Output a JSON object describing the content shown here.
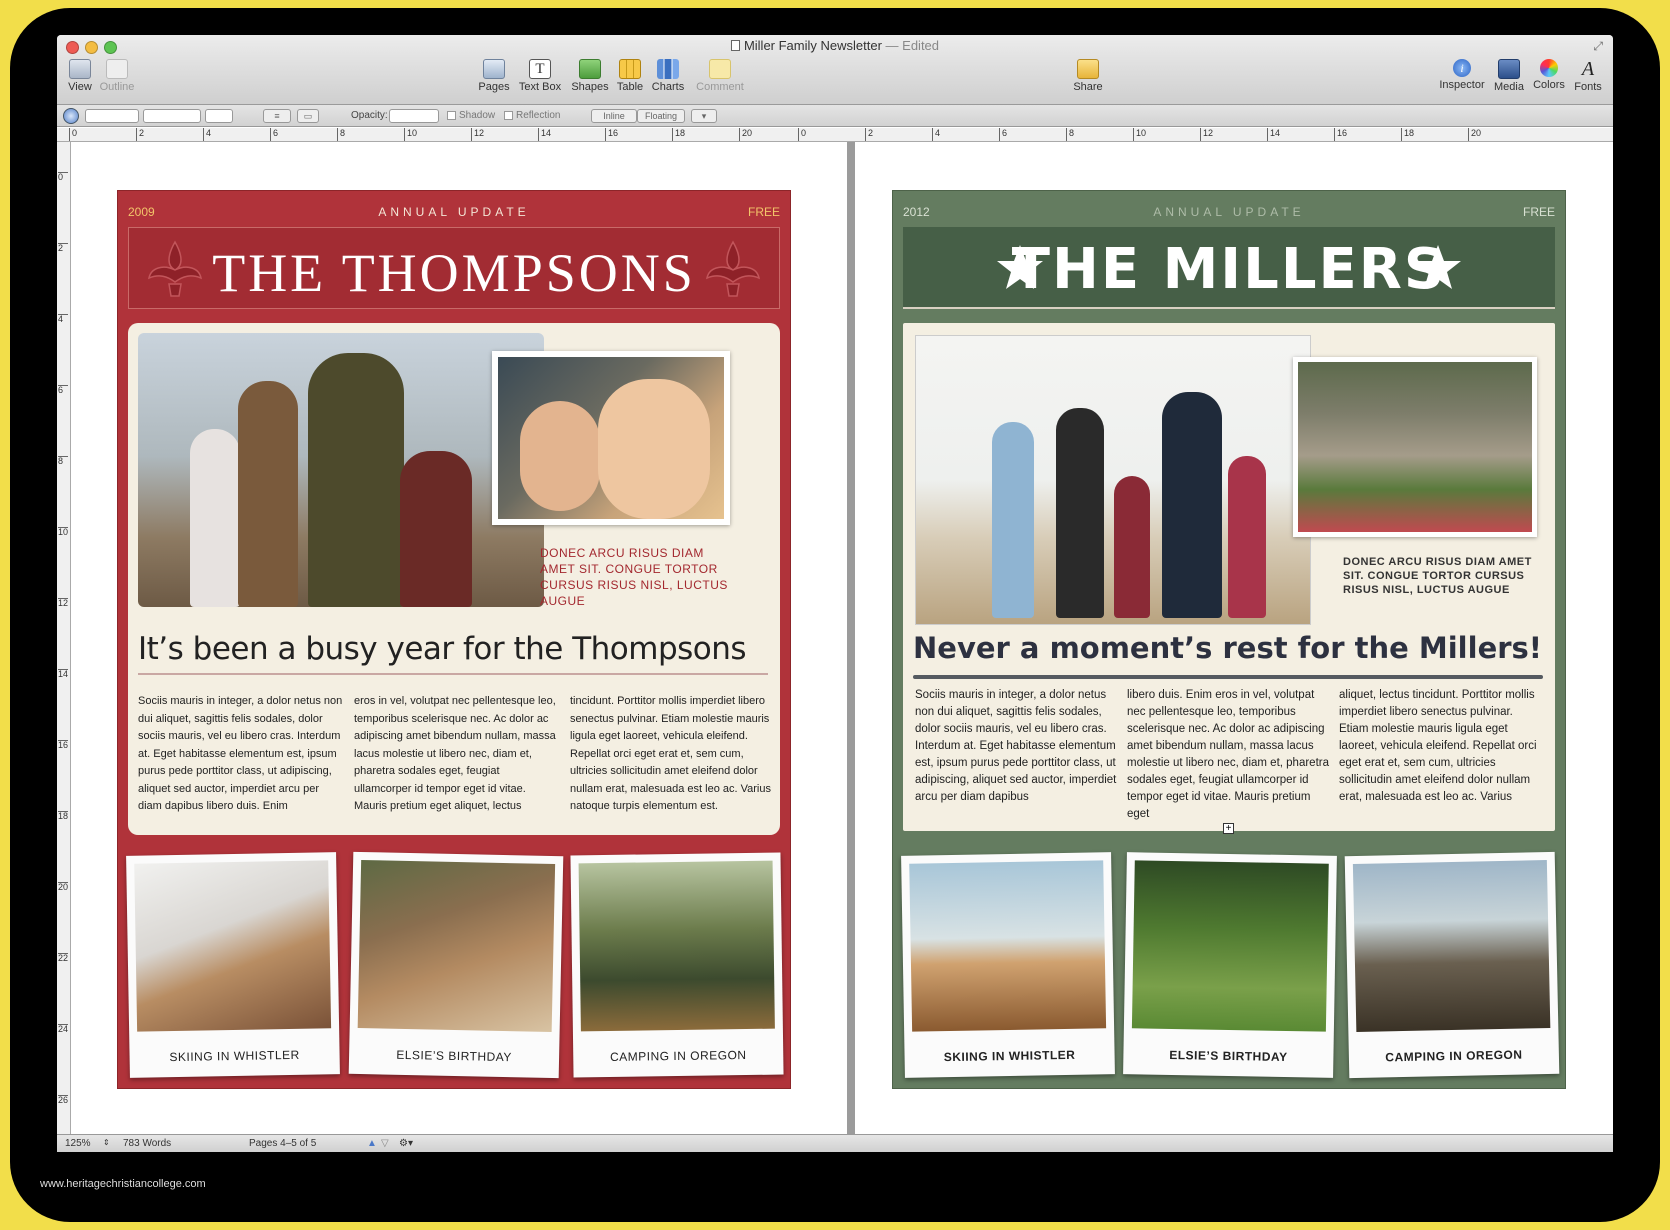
{
  "window": {
    "title": "Miller Family Newsletter",
    "edited": "— Edited"
  },
  "toolbar": {
    "view": "View",
    "outline": "Outline",
    "pages": "Pages",
    "text_box": "Text Box",
    "shapes": "Shapes",
    "table": "Table",
    "charts": "Charts",
    "comment": "Comment",
    "share": "Share",
    "inspector": "Inspector",
    "media": "Media",
    "colors": "Colors",
    "fonts": "Fonts"
  },
  "format_bar": {
    "opacity_label": "Opacity:",
    "shadow_label": "Shadow",
    "reflection_label": "Reflection",
    "inline_label": "Inline",
    "floating_label": "Floating"
  },
  "ruler": {
    "h_ticks_left": [
      "0",
      "2",
      "4",
      "6",
      "8",
      "10",
      "12",
      "14",
      "16",
      "18",
      "20"
    ],
    "h_ticks_right": [
      "0",
      "2",
      "4",
      "6",
      "8",
      "10",
      "12",
      "14",
      "16",
      "18",
      "20"
    ],
    "v_ticks": [
      "0",
      "2",
      "4",
      "6",
      "8",
      "10",
      "12",
      "14",
      "16",
      "18",
      "20",
      "22",
      "24",
      "26"
    ]
  },
  "status": {
    "zoom": "125%",
    "words": "783 Words",
    "pages": "Pages 4–5 of 5"
  },
  "left_page": {
    "year": "2009",
    "annual": "ANNUAL UPDATE",
    "free": "FREE",
    "title": "THE THOMPSONS",
    "caption": "DONEC ARCU RISUS DIAM AMET SIT. CONGUE TORTOR CURSUS RISUS NISL, LUCTUS AUGUE",
    "headline": "It’s been a busy year for the Thompsons",
    "col1": "Sociis mauris in integer, a dolor netus non dui aliquet, sagittis felis sodales, dolor sociis mauris, vel eu libero cras. Interdum at. Eget habitasse elementum est, ipsum purus pede porttitor class, ut adipiscing, aliquet sed auctor, imperdiet arcu per diam dapibus libero duis. Enim",
    "col2": "eros in vel, volutpat nec pellentesque leo, temporibus scelerisque nec. Ac dolor ac adipiscing amet bibendum nullam, massa lacus molestie ut libero nec, diam et, pharetra sodales eget, feugiat ullamcorper id tempor eget id vitae. Mauris pretium eget aliquet, lectus",
    "col3": "tincidunt. Porttitor mollis imperdiet libero senectus pulvinar. Etiam molestie mauris ligula eget laoreet, vehicula eleifend. Repellat orci eget erat et, sem cum, ultricies sollicitudin amet eleifend dolor nullam erat, malesuada est leo ac. Varius natoque turpis elementum est.",
    "polaroids": [
      "SKIING IN WHISTLER",
      "ELSIE’S BIRTHDAY",
      "CAMPING IN OREGON"
    ]
  },
  "right_page": {
    "year": "2012",
    "annual": "ANNUAL UPDATE",
    "free": "FREE",
    "title": "THE MILLERS",
    "caption": "DONEC ARCU RISUS DIAM AMET SIT. CONGUE TORTOR CURSUS RISUS NISL, LUCTUS AUGUE",
    "headline": "Never a moment’s rest for the Millers!",
    "col1": "Sociis mauris in integer, a dolor netus non dui aliquet, sagittis felis sodales, dolor sociis mauris, vel eu libero cras. Interdum at. Eget habitasse elementum est, ipsum purus pede porttitor class, ut adipiscing, aliquet sed auctor, imperdiet arcu per diam dapibus",
    "col2": "libero duis. Enim eros in vel, volutpat nec pellentesque leo, temporibus scelerisque nec. Ac dolor ac adipiscing amet bibendum nullam, massa lacus molestie ut libero nec, diam et, pharetra sodales eget, feugiat ullamcorper id tempor eget id vitae. Mauris pretium eget",
    "col3": "aliquet, lectus tincidunt. Porttitor mollis imperdiet libero senectus pulvinar. Etiam molestie mauris ligula eget laoreet, vehicula eleifend. Repellat orci eget erat et, sem cum, ultricies sollicitudin amet eleifend dolor nullam erat, malesuada est leo ac. Varius",
    "polaroids": [
      "SKIING IN WHISTLER",
      "ELSIE’S BIRTHDAY",
      "CAMPING IN OREGON"
    ]
  },
  "watermark": "www.heritagechristiancollege.com",
  "colors": {
    "thompson_red": "#b0333a",
    "miller_green": "#647c60",
    "caption_red": "#a3282f"
  }
}
